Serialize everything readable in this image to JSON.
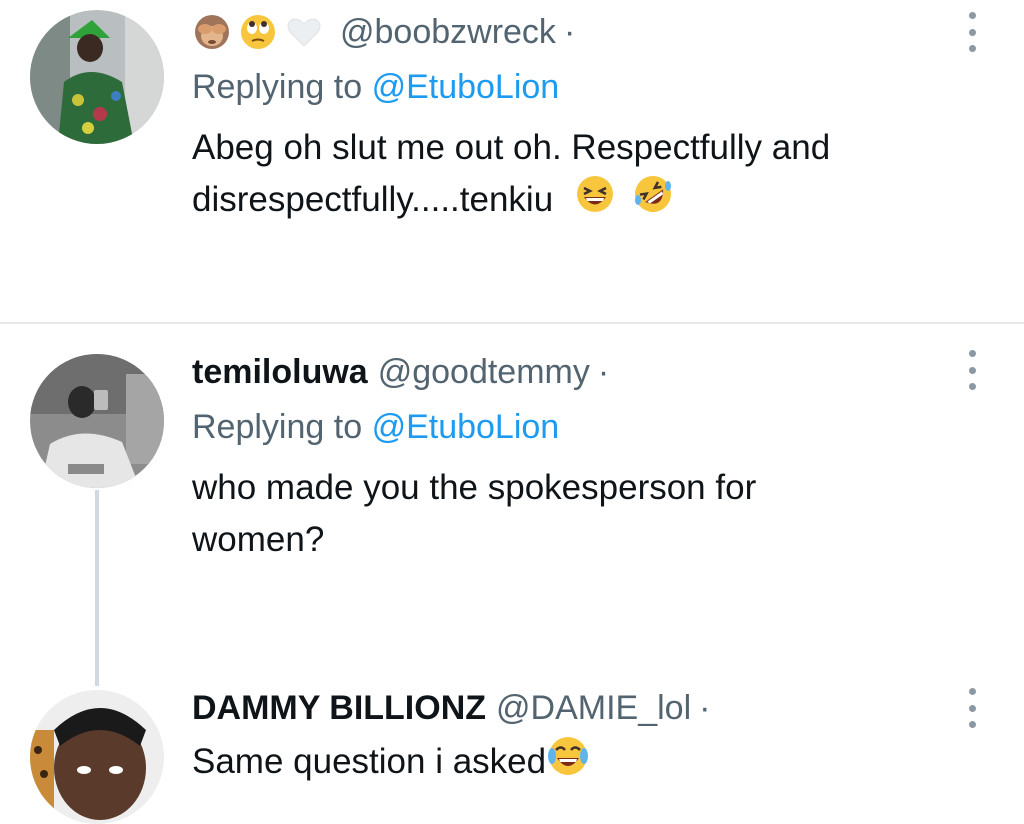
{
  "tweets": [
    {
      "display_name": "",
      "handle": "@boobzwreck",
      "separator": "·",
      "header_icons": [
        "see-no-evil-monkey-icon",
        "eye-roll-face-icon",
        "white-heart-icon"
      ],
      "replying_prefix": "Replying to",
      "replying_to": "@EtuboLion",
      "text_line1": "Abeg oh slut me out oh. Respectfully and",
      "text_line2": "disrespectfully.....tenkiu",
      "text_emojis": [
        "laughing-squint-face-icon",
        "rolling-on-floor-laughing-icon"
      ]
    },
    {
      "display_name": "temiloluwa",
      "handle": "@goodtemmy",
      "separator": "·",
      "replying_prefix": "Replying to",
      "replying_to": "@EtuboLion",
      "text_line1": "who made you the spokesperson for",
      "text_line2": "women?"
    },
    {
      "display_name": "DAMMY BILLIONZ",
      "handle": "@DAMIE_lol",
      "separator": "·",
      "text_line1": "Same question i asked",
      "text_emojis": [
        "face-with-tears-of-joy-icon"
      ]
    }
  ],
  "colors": {
    "link": "#1d9bf0",
    "secondary_text": "#536471",
    "divider": "#e6e9ec",
    "thread_line": "#cfd9de"
  }
}
